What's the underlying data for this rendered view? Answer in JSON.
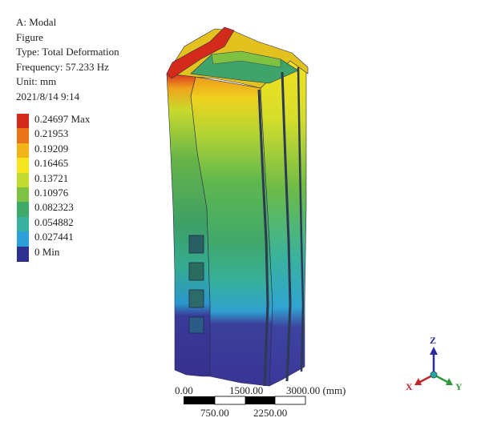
{
  "header": {
    "analysis": "A: Modal",
    "figure": "Figure",
    "type": "Type: Total Deformation",
    "frequency": "Frequency: 57.233 Hz",
    "unit": "Unit: mm",
    "date": "2021/8/14 9:14"
  },
  "legend": {
    "items": [
      {
        "label": "0.24697 Max",
        "color": "#d42a1c"
      },
      {
        "label": "0.21953",
        "color": "#e8751a"
      },
      {
        "label": "0.19209",
        "color": "#f2b519"
      },
      {
        "label": "0.16465",
        "color": "#f5e61f"
      },
      {
        "label": "0.13721",
        "color": "#c2d92e"
      },
      {
        "label": "0.10976",
        "color": "#7dc242"
      },
      {
        "label": "0.082323",
        "color": "#3fa96a"
      },
      {
        "label": "0.054882",
        "color": "#3ab09f"
      },
      {
        "label": "0.027441",
        "color": "#2d9fd9"
      },
      {
        "label": "0 Min",
        "color": "#2e2f8f"
      }
    ]
  },
  "scale": {
    "labels": {
      "zero": "0.00",
      "p750": "750.00",
      "p1500": "1500.00",
      "p2250": "2250.00",
      "p3000": "3000.00 (mm)"
    }
  },
  "triad": {
    "z": "Z",
    "x": "X",
    "y": "Y"
  }
}
